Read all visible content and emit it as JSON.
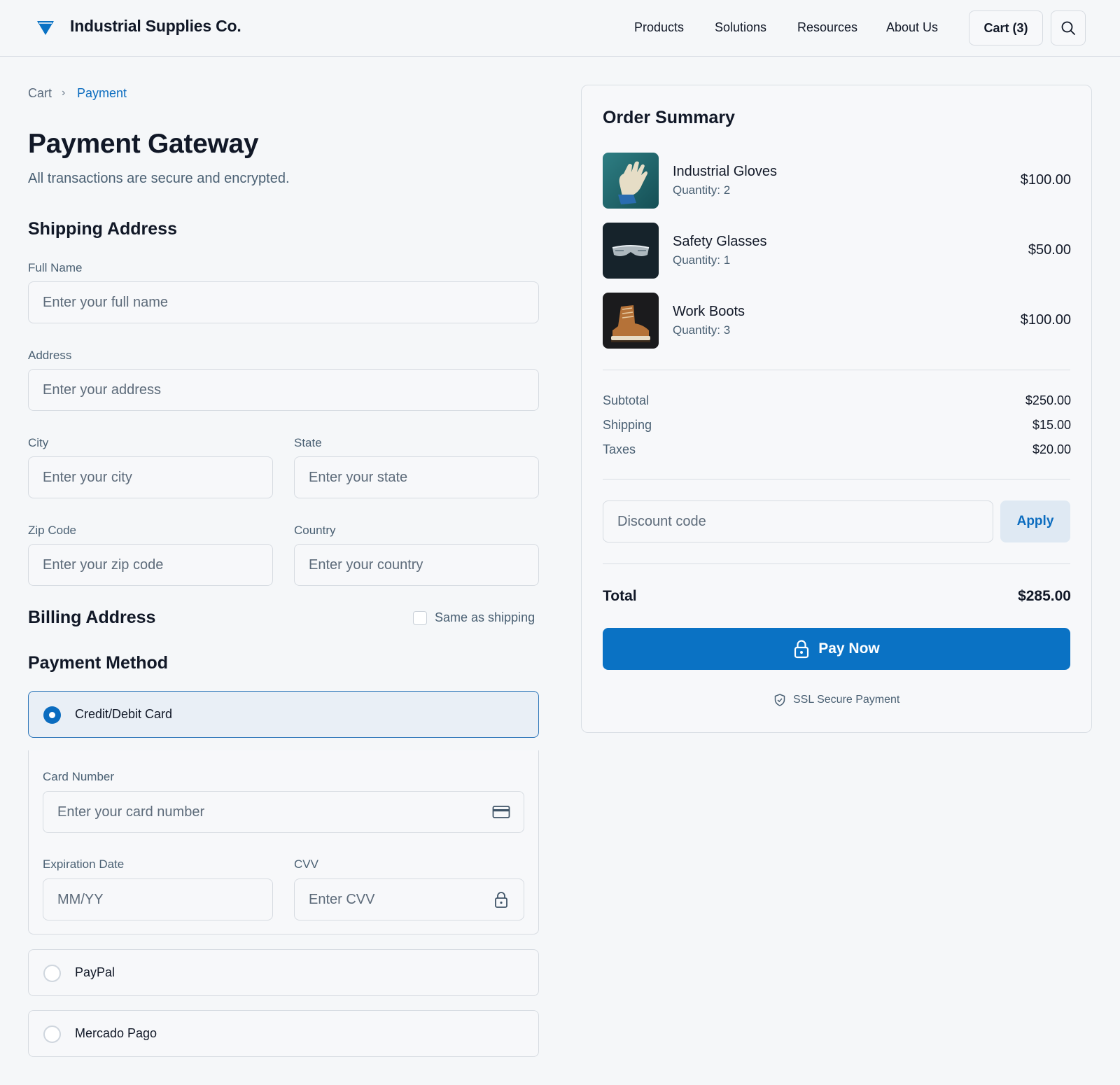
{
  "header": {
    "brand": "Industrial Supplies Co.",
    "nav": [
      "Products",
      "Solutions",
      "Resources",
      "About Us"
    ],
    "cart_label": "Cart (3)"
  },
  "breadcrumb": {
    "items": [
      "Cart",
      "Payment"
    ],
    "separator": "›"
  },
  "page": {
    "title": "Payment Gateway",
    "subtitle": "All transactions are secure and encrypted."
  },
  "shipping": {
    "title": "Shipping Address",
    "full_name": {
      "label": "Full Name",
      "placeholder": "Enter your full name",
      "value": ""
    },
    "address": {
      "label": "Address",
      "placeholder": "Enter your address",
      "value": ""
    },
    "city": {
      "label": "City",
      "placeholder": "Enter your city",
      "value": ""
    },
    "state": {
      "label": "State",
      "placeholder": "Enter your state",
      "value": ""
    },
    "zip": {
      "label": "Zip Code",
      "placeholder": "Enter your zip code",
      "value": ""
    },
    "country": {
      "label": "Country",
      "placeholder": "Enter your country",
      "value": ""
    }
  },
  "billing": {
    "title": "Billing Address",
    "same_as_shipping_label": "Same as shipping",
    "same_as_shipping_checked": false
  },
  "payment": {
    "title": "Payment Method",
    "methods": [
      {
        "label": "Credit/Debit Card",
        "selected": true
      },
      {
        "label": "PayPal",
        "selected": false
      },
      {
        "label": "Mercado Pago",
        "selected": false
      }
    ],
    "card": {
      "number": {
        "label": "Card Number",
        "placeholder": "Enter your card number",
        "icon": "credit-card-icon"
      },
      "expiry": {
        "label": "Expiration Date",
        "placeholder": "MM/YY"
      },
      "cvv": {
        "label": "CVV",
        "placeholder": "Enter CVV",
        "icon": "lock-icon"
      }
    }
  },
  "summary": {
    "title": "Order Summary",
    "items": [
      {
        "name": "Industrial Gloves",
        "qty": "Quantity: 2",
        "price": "$100.00"
      },
      {
        "name": "Safety Glasses",
        "qty": "Quantity: 1",
        "price": "$50.00"
      },
      {
        "name": "Work Boots",
        "qty": "Quantity: 3",
        "price": "$100.00"
      }
    ],
    "lines": [
      {
        "label": "Subtotal",
        "value": "$250.00"
      },
      {
        "label": "Shipping",
        "value": "$15.00"
      },
      {
        "label": "Taxes",
        "value": "$20.00"
      }
    ],
    "discount": {
      "placeholder": "Discount code",
      "apply_label": "Apply"
    },
    "total": {
      "label": "Total",
      "value": "$285.00"
    },
    "pay_label": "Pay Now",
    "ssl_label": "SSL Secure Payment"
  },
  "colors": {
    "accent": "#0a72c4",
    "link": "#0b6cbf",
    "background": "#f5f7f9",
    "selected_method_bg": "#e9eff6"
  }
}
